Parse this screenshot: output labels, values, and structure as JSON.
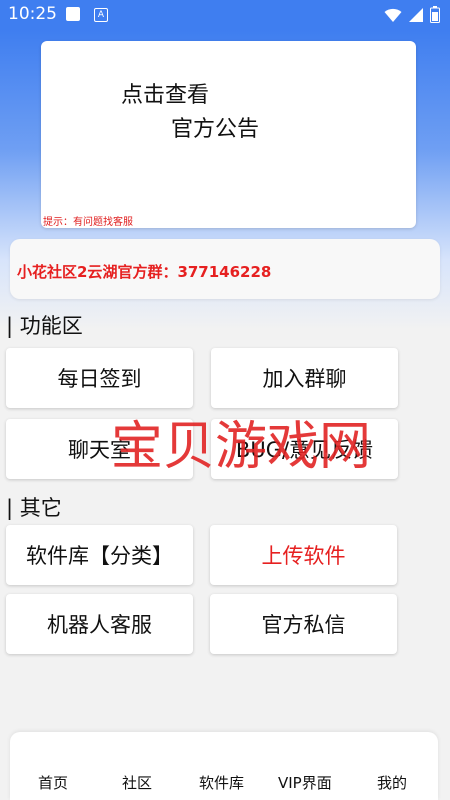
{
  "status_bar": {
    "time": "10:25",
    "notification_icon_letter": "A"
  },
  "notice": {
    "line1": "点击查看",
    "line2": "官方公告",
    "hint": "提示：有问题找客服"
  },
  "group_info": "小花社区2云湖官方群：377146228",
  "sections": {
    "functions_title": "| 功能区",
    "others_title": "| 其它"
  },
  "buttons": {
    "daily_checkin": "每日签到",
    "join_group": "加入群聊",
    "chat_room": "聊天室",
    "bug_feedback": "BUG/意见反馈",
    "software_library_category": "软件库【分类】",
    "upload_software": "上传软件",
    "robot_service": "机器人客服",
    "official_message": "官方私信"
  },
  "watermark": "宝贝游戏网",
  "nav": {
    "home": "首页",
    "community": "社区",
    "software_library": "软件库",
    "vip": "VIP界面",
    "mine": "我的"
  },
  "colors": {
    "accent_blue": "#3f7ef0",
    "highlight_red": "#e62020"
  }
}
